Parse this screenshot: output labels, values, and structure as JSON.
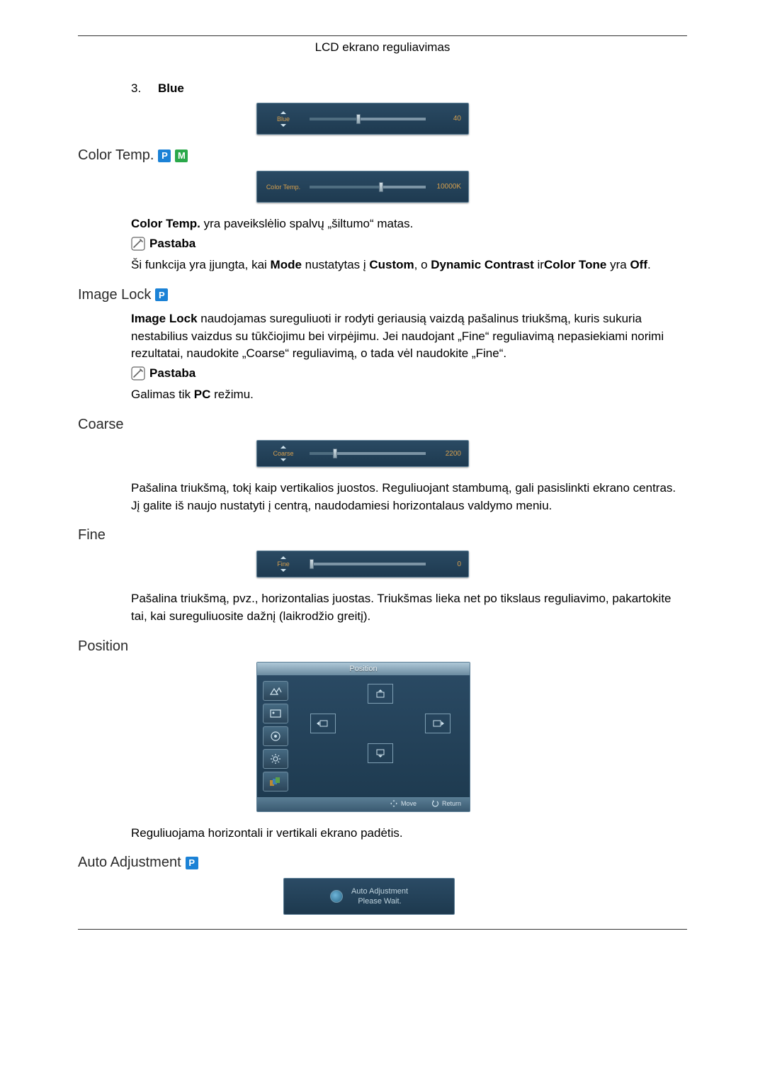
{
  "header": {
    "title": "LCD ekrano reguliavimas"
  },
  "blue_item": {
    "num": "3.",
    "label": "Blue"
  },
  "osd": {
    "blue": {
      "label": "Blue",
      "value": "40",
      "pct": 40
    },
    "color_temp": {
      "label": "Color Temp.",
      "value": "10000K",
      "pct": 60
    },
    "coarse": {
      "label": "Coarse",
      "value": "2200",
      "pct": 20
    },
    "fine": {
      "label": "Fine",
      "value": "0",
      "pct": 0
    }
  },
  "headings": {
    "color_temp": "Color Temp.",
    "image_lock": "Image Lock",
    "coarse": "Coarse",
    "fine": "Fine",
    "position": "Position",
    "auto_adjustment": "Auto Adjustment"
  },
  "tags": {
    "p": "P",
    "m": "M"
  },
  "notes": {
    "label": "Pastaba"
  },
  "color_temp_text": {
    "p1_bold": "Color Temp.",
    "p1_rest": " yra paveikslėlio spalvų „šiltumo“ matas.",
    "p2_pre": "Ši funkcija yra įjungta, kai ",
    "p2_mode": "Mode",
    "p2_mid1": " nustatytas į ",
    "p2_custom": "Custom",
    "p2_mid2": ", o ",
    "p2_dc": "Dynamic Contrast",
    "p2_mid3": " ir",
    "p2_ctone": "Color Tone",
    "p2_mid4": " yra ",
    "p2_off": "Off",
    "p2_end": "."
  },
  "image_lock_text": {
    "p1_bold": "Image Lock",
    "p1_rest": " naudojamas sureguliuoti ir rodyti geriausią vaizdą pašalinus triukšmą, kuris sukuria nestabilius vaizdus su tūkčiojimu bei virpėjimu. Jei naudojant „Fine“ reguliavimą nepasiekiami norimi rezultatai, naudokite „Coarse“ reguliavimą, o tada vėl naudokite „Fine“.",
    "p2_pre": "Galimas tik ",
    "p2_pc": "PC",
    "p2_post": " režimu."
  },
  "coarse_text": "Pašalina triukšmą, tokį kaip vertikalios juostos. Reguliuojant stambumą, gali pasislinkti ekrano centras. Jį galite iš naujo nustatyti į centrą, naudodamiesi horizontalaus valdymo meniu.",
  "fine_text": "Pašalina triukšmą, pvz., horizontalias juostas. Triukšmas lieka net po tikslaus reguliavimo, pakartokite tai, kai sureguliuosite dažnį (laikrodžio greitį).",
  "position_panel": {
    "title": "Position",
    "footer": {
      "move": "Move",
      "return": "Return"
    }
  },
  "position_text": "Reguliuojama horizontali ir vertikali ekrano padėtis.",
  "auto_box": {
    "line1": "Auto Adjustment",
    "line2": "Please Wait."
  }
}
